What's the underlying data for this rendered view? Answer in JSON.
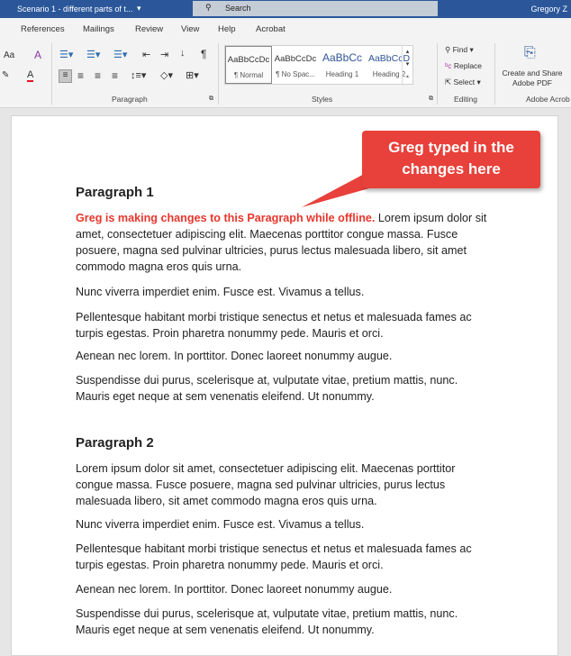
{
  "titlebar": {
    "doc_title": "Scenario 1 - different parts of t...",
    "search_placeholder": "Search",
    "user": "Gregory Z"
  },
  "tabs": [
    "References",
    "Mailings",
    "Review",
    "View",
    "Help",
    "Acrobat"
  ],
  "ribbon": {
    "paragraph_label": "Paragraph",
    "styles_label": "Styles",
    "editing_label": "Editing",
    "acrobat_label": "Adobe Acrob",
    "styles": [
      {
        "preview": "AaBbCcDc",
        "name": "¶ Normal"
      },
      {
        "preview": "AaBbCcDc",
        "name": "¶ No Spac..."
      },
      {
        "preview": "AaBbCc",
        "name": "Heading 1"
      },
      {
        "preview": "AaBbCcD",
        "name": "Heading 2"
      }
    ],
    "find": "Find",
    "replace": "Replace",
    "select": "Select",
    "create_share": "Create and Share",
    "adobe_pdf": "Adobe PDF",
    "font_size_btn": "Aa"
  },
  "callout": {
    "text": "Greg typed in the changes here",
    "color": "#e8403a"
  },
  "document": {
    "p1_heading": "Paragraph 1",
    "p1_red": "Greg is making changes to this Paragraph while offline.",
    "p1_first": " Lorem ipsum dolor sit amet, consectetuer adipiscing elit. Maecenas porttitor congue massa. Fusce posuere, magna sed pulvinar ultricies, purus lectus malesuada libero, sit amet commodo magna eros quis urna.",
    "p2_heading": "Paragraph 2",
    "p2_first": "Lorem ipsum dolor sit amet, consectetuer adipiscing elit. Maecenas porttitor congue massa. Fusce posuere, magna sed pulvinar ultricies, purus lectus malesuada libero, sit amet commodo magna eros quis urna.",
    "l2": "Nunc viverra imperdiet enim. Fusce est. Vivamus a tellus.",
    "l3": "Pellentesque habitant morbi tristique senectus et netus et malesuada fames ac turpis egestas. Proin pharetra nonummy pede. Mauris et orci.",
    "l4": "Aenean nec lorem. In porttitor. Donec laoreet nonummy augue.",
    "l5": "Suspendisse dui purus, scelerisque at, vulputate vitae, pretium mattis, nunc. Mauris eget neque at sem venenatis eleifend. Ut nonummy."
  }
}
